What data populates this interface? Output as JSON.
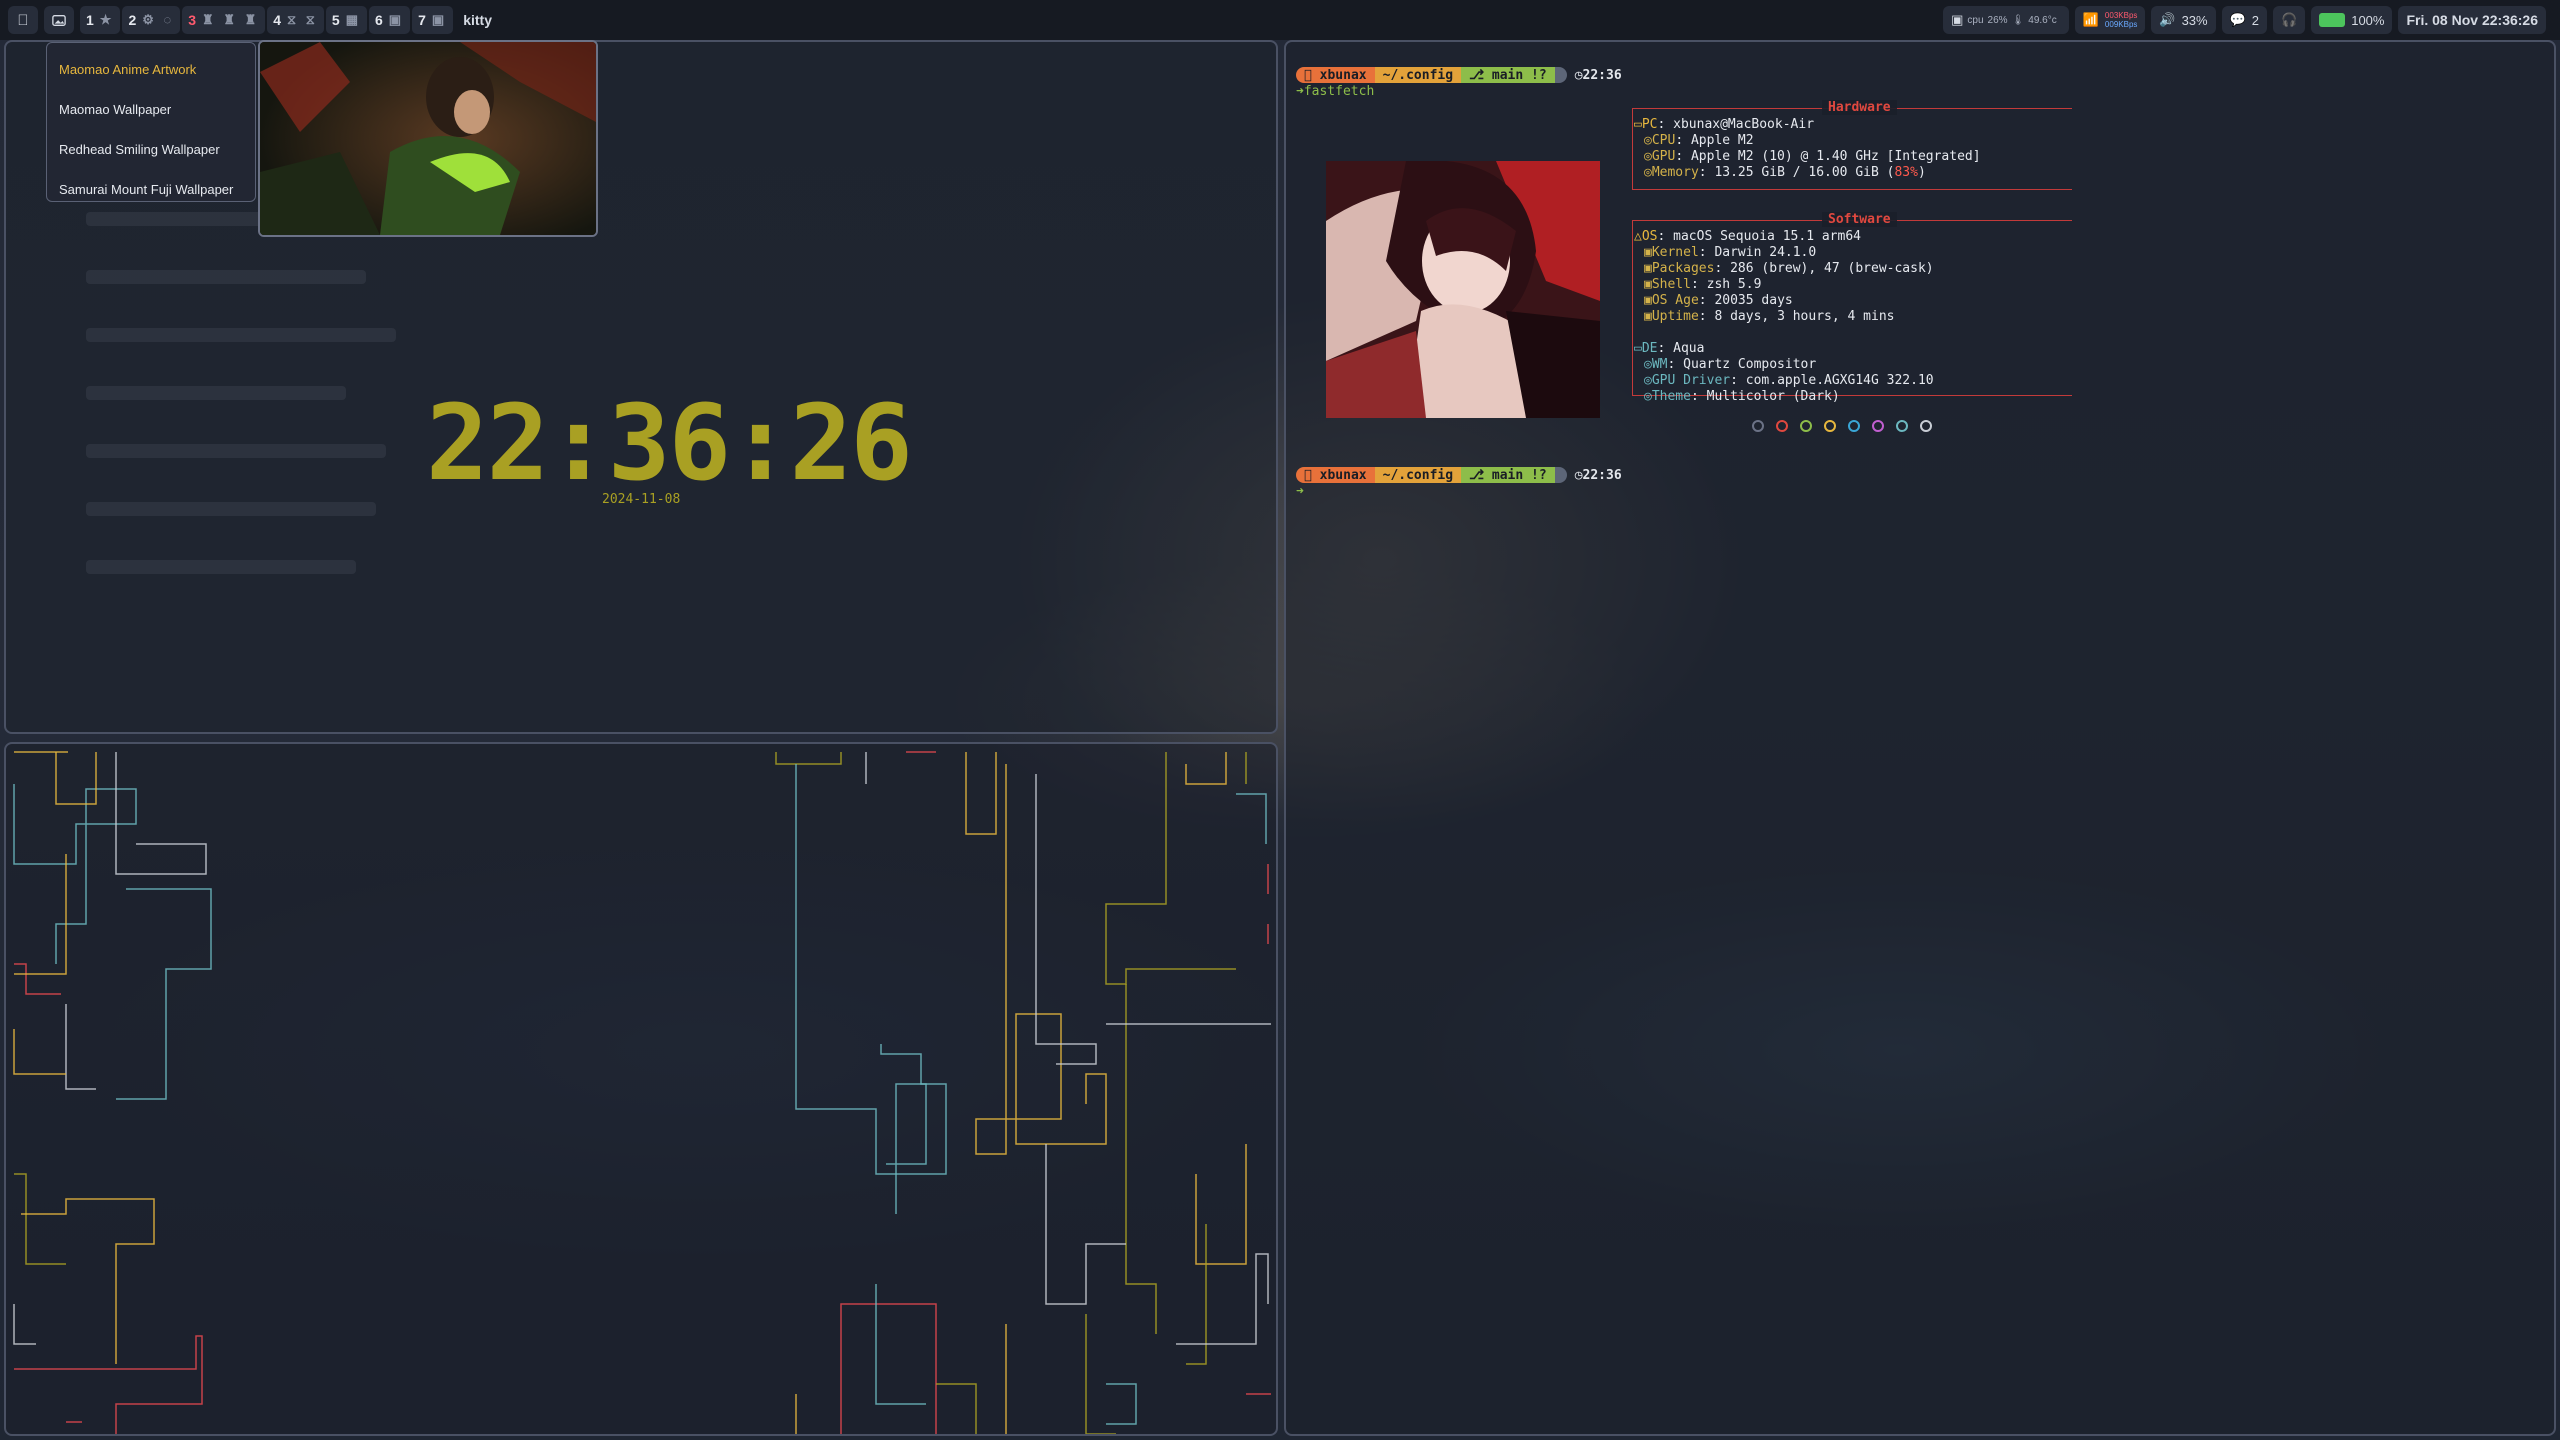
{
  "topbar": {
    "apple_icon": "apple-icon",
    "wallpaper_icon": "image-icon",
    "spaces": [
      {
        "num": "1",
        "icons": "★",
        "active": false
      },
      {
        "num": "2",
        "icons": "⚙ ◌",
        "active": false
      },
      {
        "num": "3",
        "icons": "♜ ♜ ♜",
        "active": true
      },
      {
        "num": "4",
        "icons": "⧖ ⧖",
        "active": false
      },
      {
        "num": "5",
        "icons": "▦",
        "active": false
      },
      {
        "num": "6",
        "icons": "▣",
        "active": false
      },
      {
        "num": "7",
        "icons": "▣",
        "active": false
      }
    ],
    "front_app": "kitty",
    "cpu_label": "cpu",
    "cpu_value": "26%",
    "temp_value": "49.6°c",
    "net_up": "003KBps",
    "net_down": "009KBps",
    "volume": "33%",
    "notifications": "2",
    "battery": "100%",
    "date": "Fri. 08 Nov",
    "time": "22:36:26"
  },
  "menu": {
    "items": [
      {
        "label": "Maomao Anime Artwork",
        "selected": true
      },
      {
        "label": "Maomao Wallpaper",
        "selected": false
      },
      {
        "label": "Redhead Smiling Wallpaper",
        "selected": false
      },
      {
        "label": "Samurai Mount Fuji Wallpaper",
        "selected": false
      }
    ]
  },
  "clock": {
    "time": "22:36:26",
    "date": "2024-11-08",
    "color": "#a9a023"
  },
  "terminal": {
    "prompt": {
      "user": "xbunax",
      "dir": "~/.config",
      "git": "main !?",
      "time": "22:36"
    },
    "command": "fastfetch",
    "hardware_title": "Hardware",
    "software_title": "Software",
    "hardware": [
      {
        "key": "PC",
        "value": "xbunax@MacBook-Air"
      },
      {
        "key": "CPU",
        "value": "Apple M2"
      },
      {
        "key": "GPU",
        "value": "Apple M2 (10) @ 1.40 GHz [Integrated]"
      },
      {
        "key": "Memory",
        "value": "13.25 GiB / 16.00 GiB (",
        "percent": "83%",
        "tail": ")"
      }
    ],
    "software": [
      {
        "key": "OS",
        "value": "macOS Sequoia 15.1 arm64"
      },
      {
        "key": "Kernel",
        "value": "Darwin 24.1.0"
      },
      {
        "key": "Packages",
        "value": "286 (brew), 47 (brew-cask)"
      },
      {
        "key": "Shell",
        "value": "zsh 5.9"
      },
      {
        "key": "OS Age",
        "value": "20035 days"
      },
      {
        "key": "Uptime",
        "value": "8 days, 3 hours, 4 mins"
      }
    ],
    "desktop": [
      {
        "key": "DE",
        "value": "Aqua"
      },
      {
        "key": "WM",
        "value": "Quartz Compositor"
      },
      {
        "key": "GPU Driver",
        "value": "com.apple.AGXG14G 322.10"
      },
      {
        "key": "Theme",
        "value": "Multicolor (Dark)"
      }
    ],
    "color_dots": [
      "#6b7286",
      "#e0483f",
      "#8dbd4a",
      "#e7b73e",
      "#3aa6d6",
      "#c15fd0",
      "#6cb8c0",
      "#c8ccd4"
    ],
    "cursor": "➜"
  },
  "pipes_colors": [
    "#e7b73e",
    "#6cb8c0",
    "#e0484f",
    "#a9a023",
    "#c8ccd4"
  ]
}
